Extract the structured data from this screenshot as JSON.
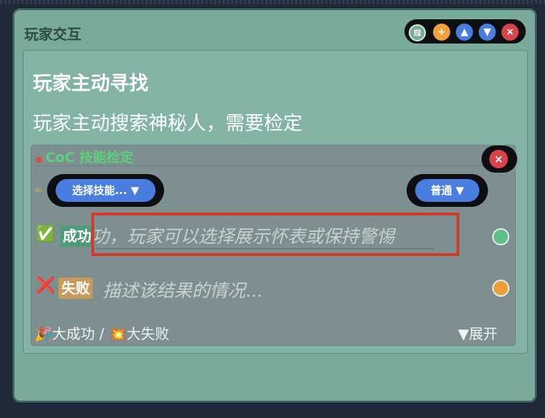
{
  "card": {
    "title": "玩家交互",
    "toolbar": {
      "note_icon": "note-icon",
      "add_label": "+",
      "up_label": "▲",
      "down_label": "▼",
      "close_label": "×"
    }
  },
  "content": {
    "heading": "玩家主动寻找",
    "description": "玩家主动搜索神秘人，需要检定"
  },
  "check": {
    "dice_icon": "●",
    "title": "CoC 技能检定",
    "close_label": "×",
    "pencil_icon": "✏",
    "skill_select": "选择技能... ▼",
    "difficulty_select": "普通 ▼",
    "success": {
      "icon": "✅",
      "label": "成功",
      "text": "功，玩家可以选择展示怀表或保持警惕"
    },
    "fail": {
      "icon": "❌",
      "label": "失败",
      "placeholder": "描述该结果的情况..."
    },
    "footer_left": "🎉大成功 / 💥大失败",
    "footer_right": "▼展开"
  },
  "colors": {
    "card_bg": "#79aa9a",
    "accent_blue": "#4a7de0",
    "success_green": "#5fbf86",
    "fail_orange": "#eaa03a",
    "danger_red": "#d9434b",
    "check_title_green": "#5cd07a"
  }
}
